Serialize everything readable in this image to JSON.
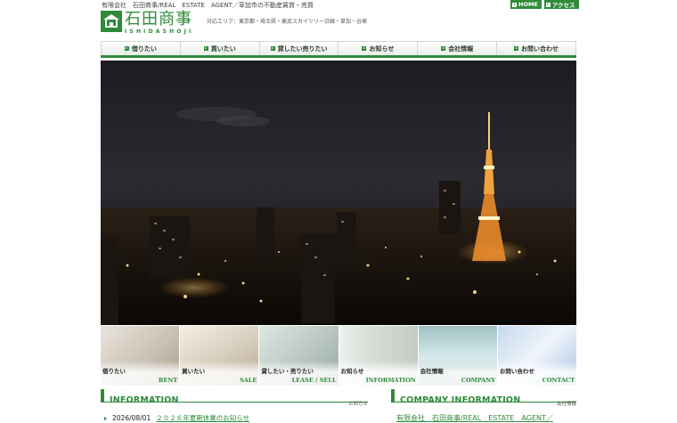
{
  "header": {
    "tagline": "有限会社　石田商事/REAL　ESTATE　AGENT／草加市の不動産賃貸・売買",
    "logo_name": "石田商事",
    "logo_roman": "ISHIDASHOJI",
    "area": "対応エリア：東京都・埼玉県・東武スカイツリー沿線・草加・谷塚",
    "top_links": [
      {
        "label": "HOME"
      },
      {
        "label": "アクセス"
      }
    ]
  },
  "nav": [
    {
      "label": "借りたい"
    },
    {
      "label": "買いたい"
    },
    {
      "label": "貸したい売りたい"
    },
    {
      "label": "お知らせ"
    },
    {
      "label": "会社情報"
    },
    {
      "label": "お問い合わせ"
    }
  ],
  "tiles": [
    {
      "jp": "借りたい",
      "en": "RENT"
    },
    {
      "jp": "買いたい",
      "en": "SALE"
    },
    {
      "jp": "貸したい・売りたい",
      "en": "LEASE / SELL"
    },
    {
      "jp": "お知らせ",
      "en": "INFORMATION"
    },
    {
      "jp": "会社情報",
      "en": "COMPANY"
    },
    {
      "jp": "お問い合わせ",
      "en": "CONTACT"
    }
  ],
  "information": {
    "title": "INFORMATION",
    "subtitle": "お知らせ",
    "items": [
      {
        "date": "2026/08/01",
        "text": "２０２６年夏期休業のお知らせ"
      }
    ]
  },
  "company": {
    "title": "COMPANY INFORMATION",
    "subtitle": "会社情報",
    "link": "有限会社　石田商事/REAL　ESTATE　AGENT／"
  },
  "colors": {
    "accent": "#2f8b3a"
  }
}
